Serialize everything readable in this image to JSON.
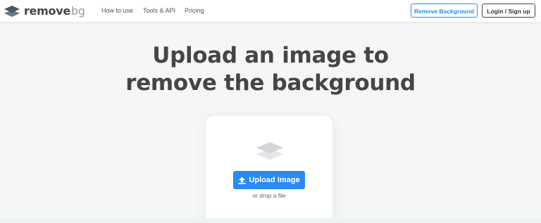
{
  "header": {
    "logo": {
      "icon": "layers-icon",
      "text_main": "remove",
      "text_accent": "bg"
    },
    "nav": [
      {
        "label": "How to use"
      },
      {
        "label": "Tools & API"
      },
      {
        "label": "Pricing"
      }
    ],
    "remove_background_label": "Remove Background",
    "login_label": "Login / Sign up"
  },
  "hero": {
    "title_line1": "Upload an image to",
    "title_line2": "remove the background"
  },
  "upload": {
    "icon": "layers-icon",
    "button_icon": "upload-icon",
    "button_label": "Upload Image",
    "drop_text": "or drop a file"
  },
  "colors": {
    "accent": "#2a8bf2",
    "text_dark": "#454545",
    "background": "#f5f6f7"
  }
}
